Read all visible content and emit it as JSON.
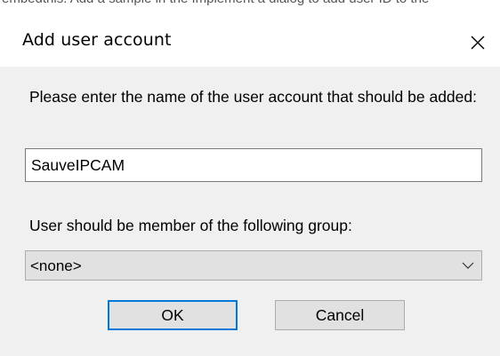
{
  "background_text": "embedthis. Add a sample in the Implement a dialog to add user ID to the",
  "dialog": {
    "title": "Add user account",
    "prompt": "Please enter the name of the user account that should be added:",
    "username_value": "SauveIPCAM",
    "group_label": "User should be member of the following group:",
    "group_selected": "<none>",
    "ok_label": "OK",
    "cancel_label": "Cancel",
    "close_icon": "close-icon",
    "dropdown_icon": "chevron-down-icon"
  },
  "colors": {
    "accent": "#0078d7",
    "content_bg": "#f0f0f0",
    "button_bg": "#e1e1e1"
  }
}
